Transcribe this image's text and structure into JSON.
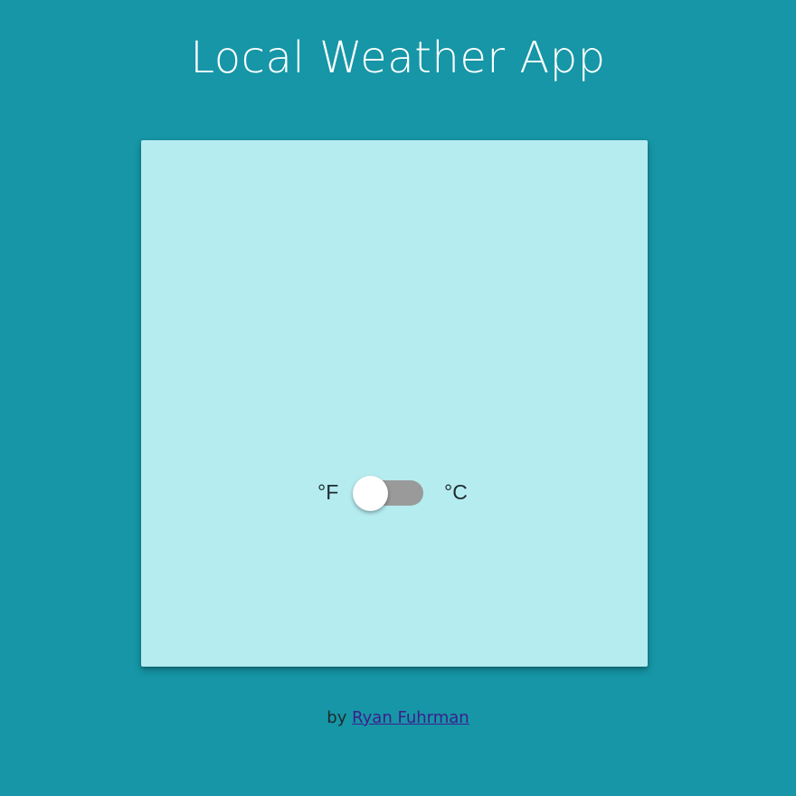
{
  "header": {
    "title": "Local Weather App"
  },
  "card": {
    "background_color": "#b5ecf0",
    "units": {
      "fahrenheit_label": "°F",
      "celsius_label": "°C",
      "toggle_state": "fahrenheit"
    }
  },
  "footer": {
    "by_text": "by",
    "author_link_text": "Ryan Fuhrman"
  },
  "colors": {
    "page_background": "#1696a6",
    "title_text": "#ffffff",
    "toggle_track": "#9a9a9a",
    "toggle_thumb": "#ffffff",
    "link": "#3d1d8e"
  }
}
